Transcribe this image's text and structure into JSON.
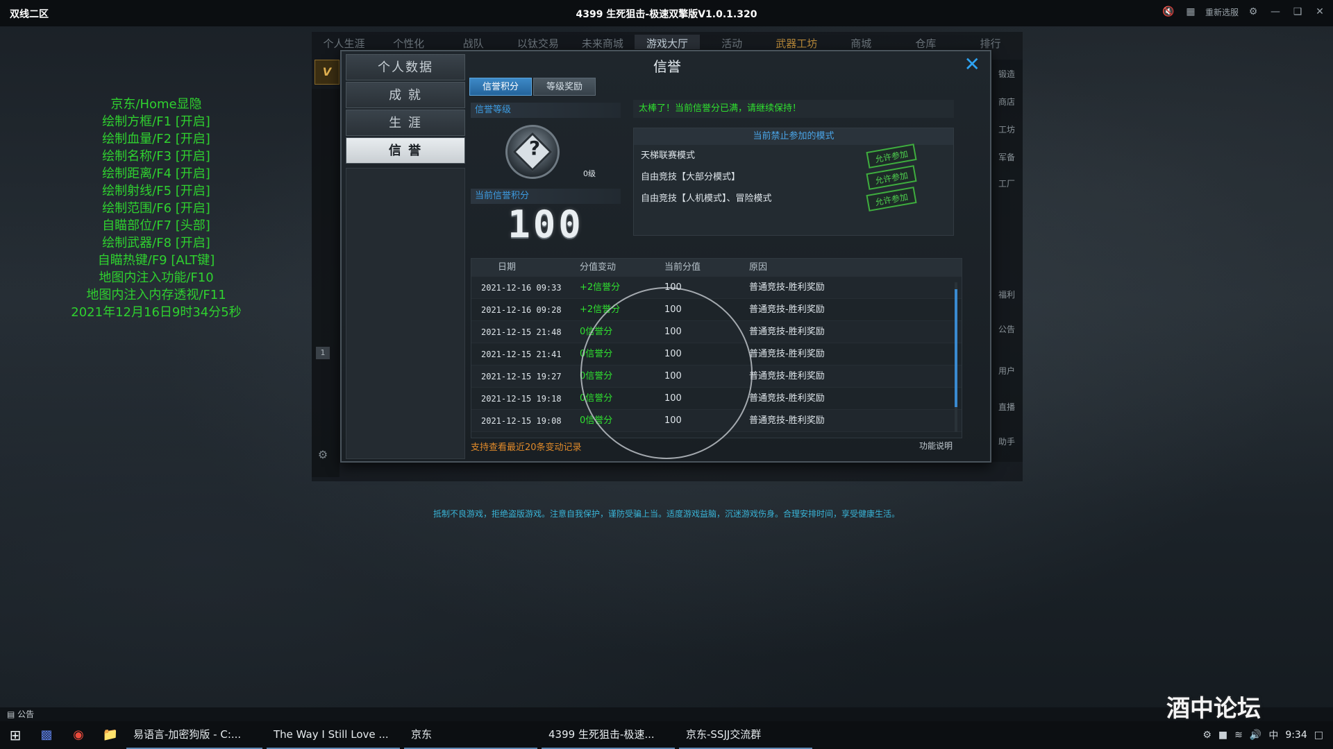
{
  "titlebar": {
    "server": "双线二区",
    "title": "4399 生死狙击-极速双擎版V1.0.1.320",
    "reselect": "重新选服"
  },
  "overlay": [
    "京东/Home显隐",
    "绘制方框/F1 [开启]",
    "绘制血量/F2 [开启]",
    "绘制名称/F3 [开启]",
    "绘制距离/F4 [开启]",
    "绘制射线/F5 [开启]",
    "绘制范围/F6 [开启]",
    "自瞄部位/F7 [头部]",
    "绘制武器/F8 [开启]",
    "自瞄热键/F9 [ALT键]",
    "地图内注入功能/F10",
    "地图内注入内存透视/F11",
    "2021年12月16日9时34分5秒"
  ],
  "topnav": [
    "个人生涯",
    "个性化",
    "战队",
    "以钛交易",
    "未来商城",
    "游戏大厅",
    "活动",
    "武器工坊",
    "商城",
    "仓库",
    "排行"
  ],
  "right_strip": [
    "锻造",
    "商店",
    "工坊",
    "军备",
    "工厂",
    "福利",
    "公告",
    "用户",
    "直播",
    "助手"
  ],
  "dialog": {
    "title": "信誉",
    "side_menu": [
      "个人数据",
      "成  就",
      "生  涯",
      "信  誉"
    ],
    "tabs": [
      "信誉积分",
      "等级奖励"
    ],
    "level_label": "信誉等级",
    "level_value": "0级",
    "score_label": "当前信誉积分",
    "score": "100",
    "notice": "太棒了！当前信誉分已满，请继续保持！",
    "modes_header": "当前禁止参加的模式",
    "modes": [
      {
        "name": "天梯联赛模式",
        "stamp": "允许参加"
      },
      {
        "name": "自由竞技【大部分模式】",
        "stamp": "允许参加"
      },
      {
        "name": "自由竞技【人机模式】、冒险模式",
        "stamp": "允许参加"
      }
    ],
    "history_headers": [
      "日期",
      "分值变动",
      "当前分值",
      "原因"
    ],
    "history": [
      {
        "date": "2021-12-16 09:33",
        "delta": "+2信誉分",
        "current": "100",
        "reason": "普通竞技-胜利奖励"
      },
      {
        "date": "2021-12-16 09:28",
        "delta": "+2信誉分",
        "current": "100",
        "reason": "普通竞技-胜利奖励"
      },
      {
        "date": "2021-12-15 21:48",
        "delta": "0信誉分",
        "current": "100",
        "reason": "普通竞技-胜利奖励"
      },
      {
        "date": "2021-12-15 21:41",
        "delta": "0信誉分",
        "current": "100",
        "reason": "普通竞技-胜利奖励"
      },
      {
        "date": "2021-12-15 19:27",
        "delta": "0信誉分",
        "current": "100",
        "reason": "普通竞技-胜利奖励"
      },
      {
        "date": "2021-12-15 19:18",
        "delta": "0信誉分",
        "current": "100",
        "reason": "普通竞技-胜利奖励"
      },
      {
        "date": "2021-12-15 19:08",
        "delta": "0信誉分",
        "current": "100",
        "reason": "普通竞技-胜利奖励"
      }
    ],
    "footer_note": "支持查看最近20条变动记录",
    "help": "功能说明"
  },
  "health_notice": "抵制不良游戏，拒绝盗版游戏。注意自我保护，谨防受骗上当。适度游戏益脑，沉迷游戏伤身。合理安排时间，享受健康生活。",
  "noticebar": "公告",
  "taskbar": {
    "tasks": [
      "易语言-加密狗版 - C:...",
      "The Way I Still Love ...",
      "京东",
      "4399 生死狙击-极速...",
      "京东-SSJJ交流群"
    ],
    "time": "9:34",
    "ime": "中"
  },
  "watermark": "酒中论坛"
}
